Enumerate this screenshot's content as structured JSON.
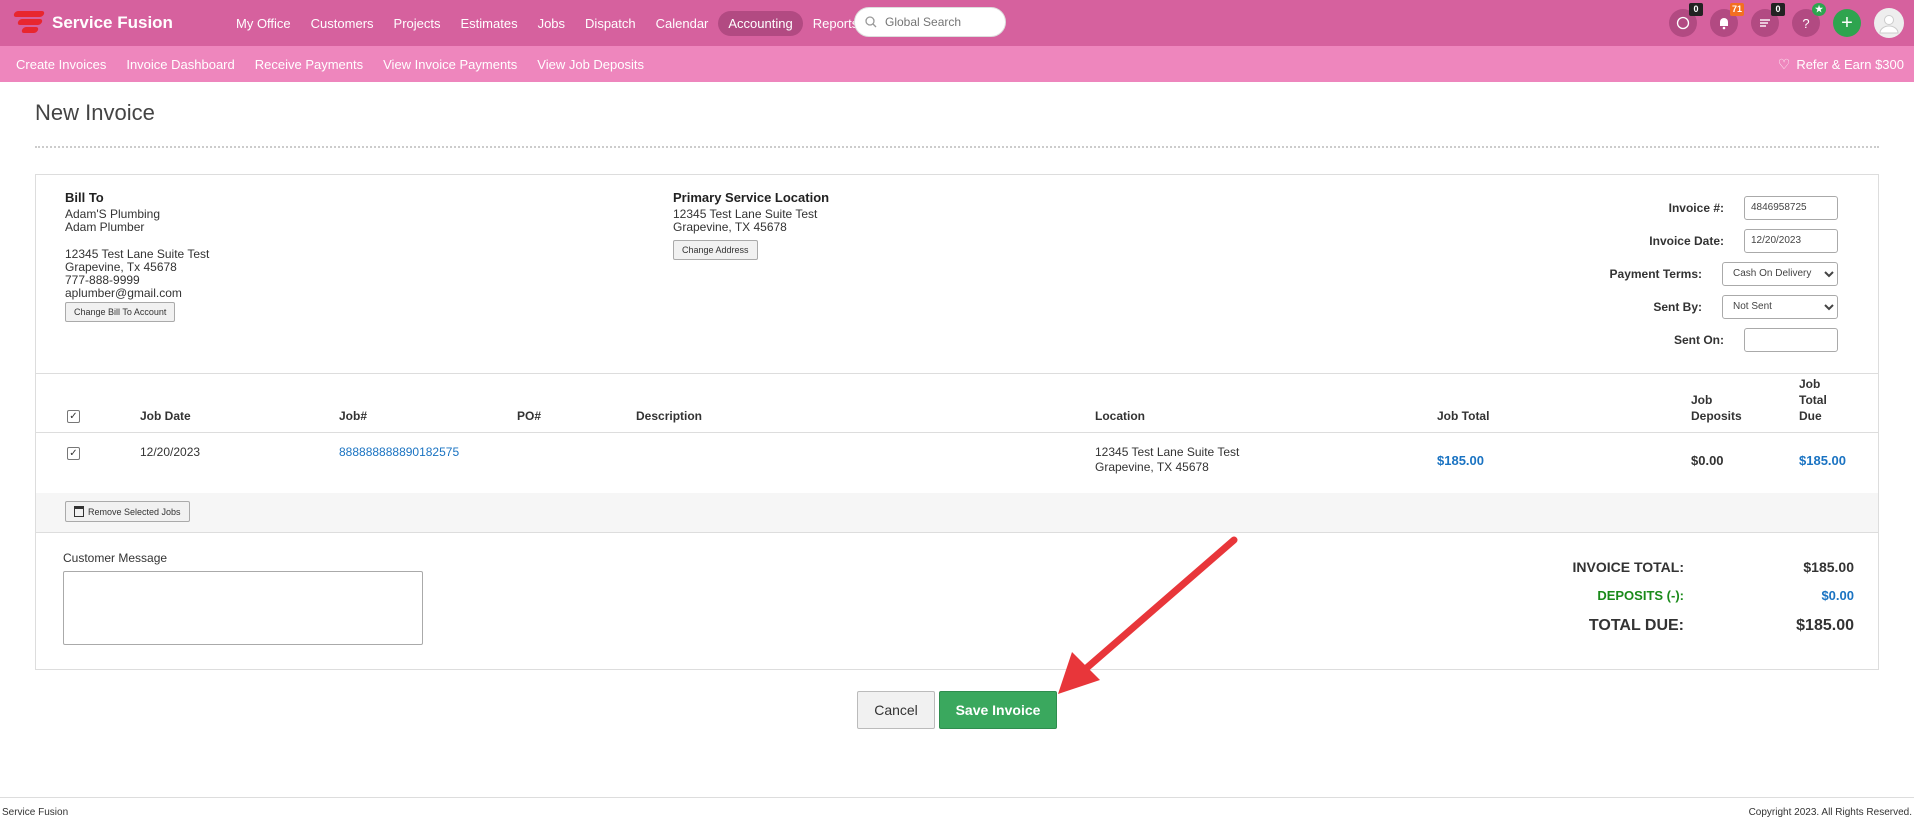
{
  "app": {
    "name": "Service Fusion"
  },
  "nav": {
    "items": [
      "My Office",
      "Customers",
      "Projects",
      "Estimates",
      "Jobs",
      "Dispatch",
      "Calendar",
      "Accounting",
      "Reports"
    ],
    "active": "Accounting"
  },
  "search": {
    "placeholder": "Global Search"
  },
  "badges": {
    "chat": "0",
    "notifications": "71",
    "tasks": "0"
  },
  "subnav": {
    "items": [
      "Create Invoices",
      "Invoice Dashboard",
      "Receive Payments",
      "View Invoice Payments",
      "View Job Deposits"
    ],
    "refer": "Refer & Earn $300"
  },
  "page": {
    "title": "New Invoice"
  },
  "bill_to": {
    "heading": "Bill To",
    "company": "Adam'S Plumbing",
    "contact": "Adam Plumber",
    "street": "12345 Test Lane Suite Test",
    "city": "Grapevine, Tx 45678",
    "phone": "777-888-9999",
    "email": "aplumber@gmail.com",
    "button": "Change Bill To Account"
  },
  "service_location": {
    "heading": "Primary Service Location",
    "street": "12345 Test Lane Suite Test",
    "city": "Grapevine, TX 45678",
    "button": "Change Address"
  },
  "invoice": {
    "number_label": "Invoice #:",
    "number": "4846958725",
    "date_label": "Invoice Date:",
    "date": "12/20/2023",
    "terms_label": "Payment Terms:",
    "terms": "Cash On Delivery",
    "sent_by_label": "Sent By:",
    "sent_by": "Not Sent",
    "sent_on_label": "Sent On:",
    "sent_on": ""
  },
  "table": {
    "headers": {
      "job_date": "Job Date",
      "job_num": "Job#",
      "po": "PO#",
      "description": "Description",
      "location": "Location",
      "job_total": "Job Total",
      "deposits": "Job Deposits",
      "total_due": "Job Total Due"
    },
    "rows": [
      {
        "job_date": "12/20/2023",
        "job_num": "888888888890182575",
        "po": "",
        "description": "",
        "location_line1": "12345 Test Lane Suite Test",
        "location_line2": "Grapevine, TX 45678",
        "job_total": "$185.00",
        "deposits": "$0.00",
        "total_due": "$185.00"
      }
    ],
    "remove_button": "Remove Selected Jobs"
  },
  "customer_message": {
    "label": "Customer Message"
  },
  "totals": {
    "invoice_total_label": "INVOICE TOTAL:",
    "invoice_total": "$185.00",
    "deposits_label": "DEPOSITS (-):",
    "deposits": "$0.00",
    "total_due_label": "TOTAL DUE:",
    "total_due": "$185.00"
  },
  "actions": {
    "cancel": "Cancel",
    "save": "Save Invoice"
  },
  "footer": {
    "left": "Service Fusion",
    "right": "Copyright 2023. All Rights Reserved."
  },
  "colors": {
    "topbar": "#d6619e",
    "subbar": "#ee86bd",
    "save": "#3aa85e",
    "link": "#1a73c2",
    "deposits_label": "#1a8a1a",
    "arrow": "#e8363a"
  }
}
